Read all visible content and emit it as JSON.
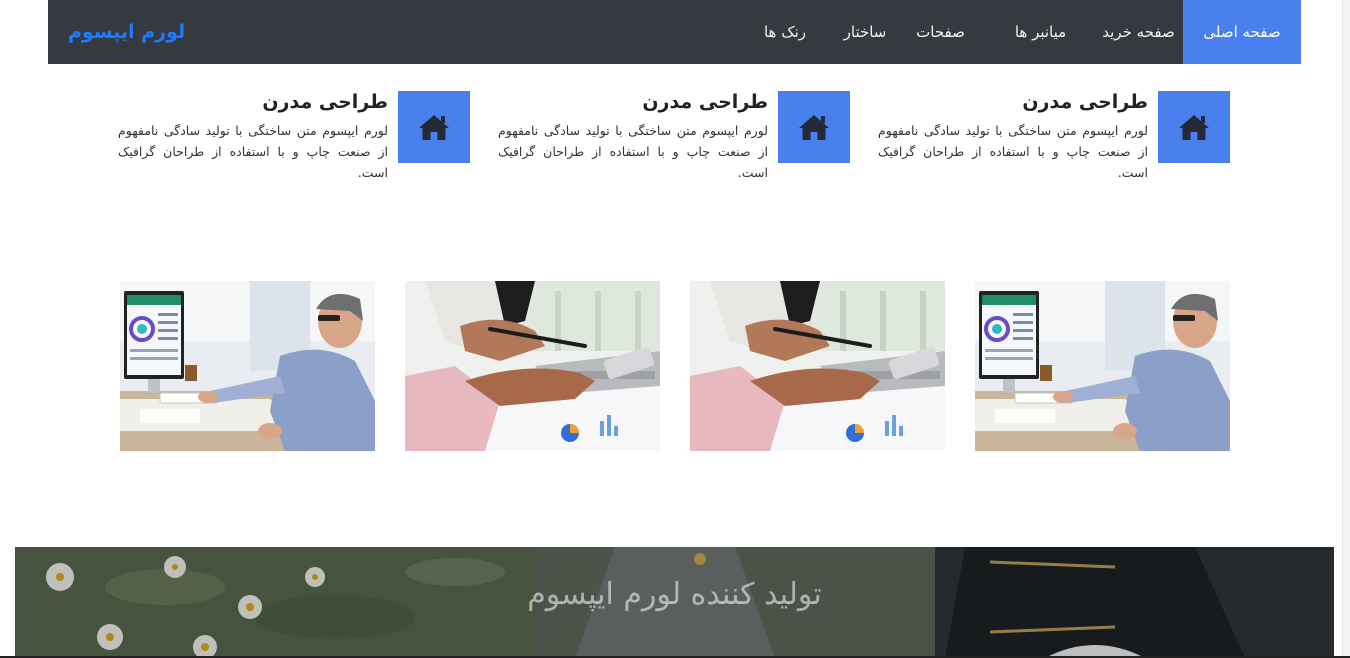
{
  "navbar": {
    "brand": "لورم ایپسوم",
    "items": [
      {
        "label": "صفحه اصلی",
        "active": true
      },
      {
        "label": "صفحه خرید",
        "active": false
      },
      {
        "label": "میانبر ها",
        "active": false
      },
      {
        "label": "صفحات",
        "active": false
      },
      {
        "label": "ساختار",
        "active": false
      },
      {
        "label": "رنک ها",
        "active": false
      }
    ]
  },
  "features": [
    {
      "icon": "home-icon",
      "title": "طراحی مدرن",
      "text": "لورم ایپسوم متن ساختگی با تولید سادگی نامفهوم از صنعت چاپ و با استفاده از طراحان گرافیک است."
    },
    {
      "icon": "home-icon",
      "title": "طراحی مدرن",
      "text": "لورم ایپسوم متن ساختگی با تولید سادگی نامفهوم از صنعت چاپ و با استفاده از طراحان گرافیک است."
    },
    {
      "icon": "home-icon",
      "title": "طراحی مدرن",
      "text": "لورم ایپسوم متن ساختگی با تولید سادگی نامفهوم از صنعت چاپ و با استفاده از طراحان گرافیک است."
    }
  ],
  "gallery": [
    {
      "subject": "man-at-computer-photo"
    },
    {
      "subject": "hands-with-pen-and-phone-photo"
    },
    {
      "subject": "hands-with-pen-and-phone-photo"
    },
    {
      "subject": "man-at-computer-photo"
    }
  ],
  "banner": {
    "title": "تولید کننده لورم ایپسوم"
  },
  "colors": {
    "navbar_bg": "#343a40",
    "accent": "#4a80ee",
    "brand": "#1e7bff"
  }
}
